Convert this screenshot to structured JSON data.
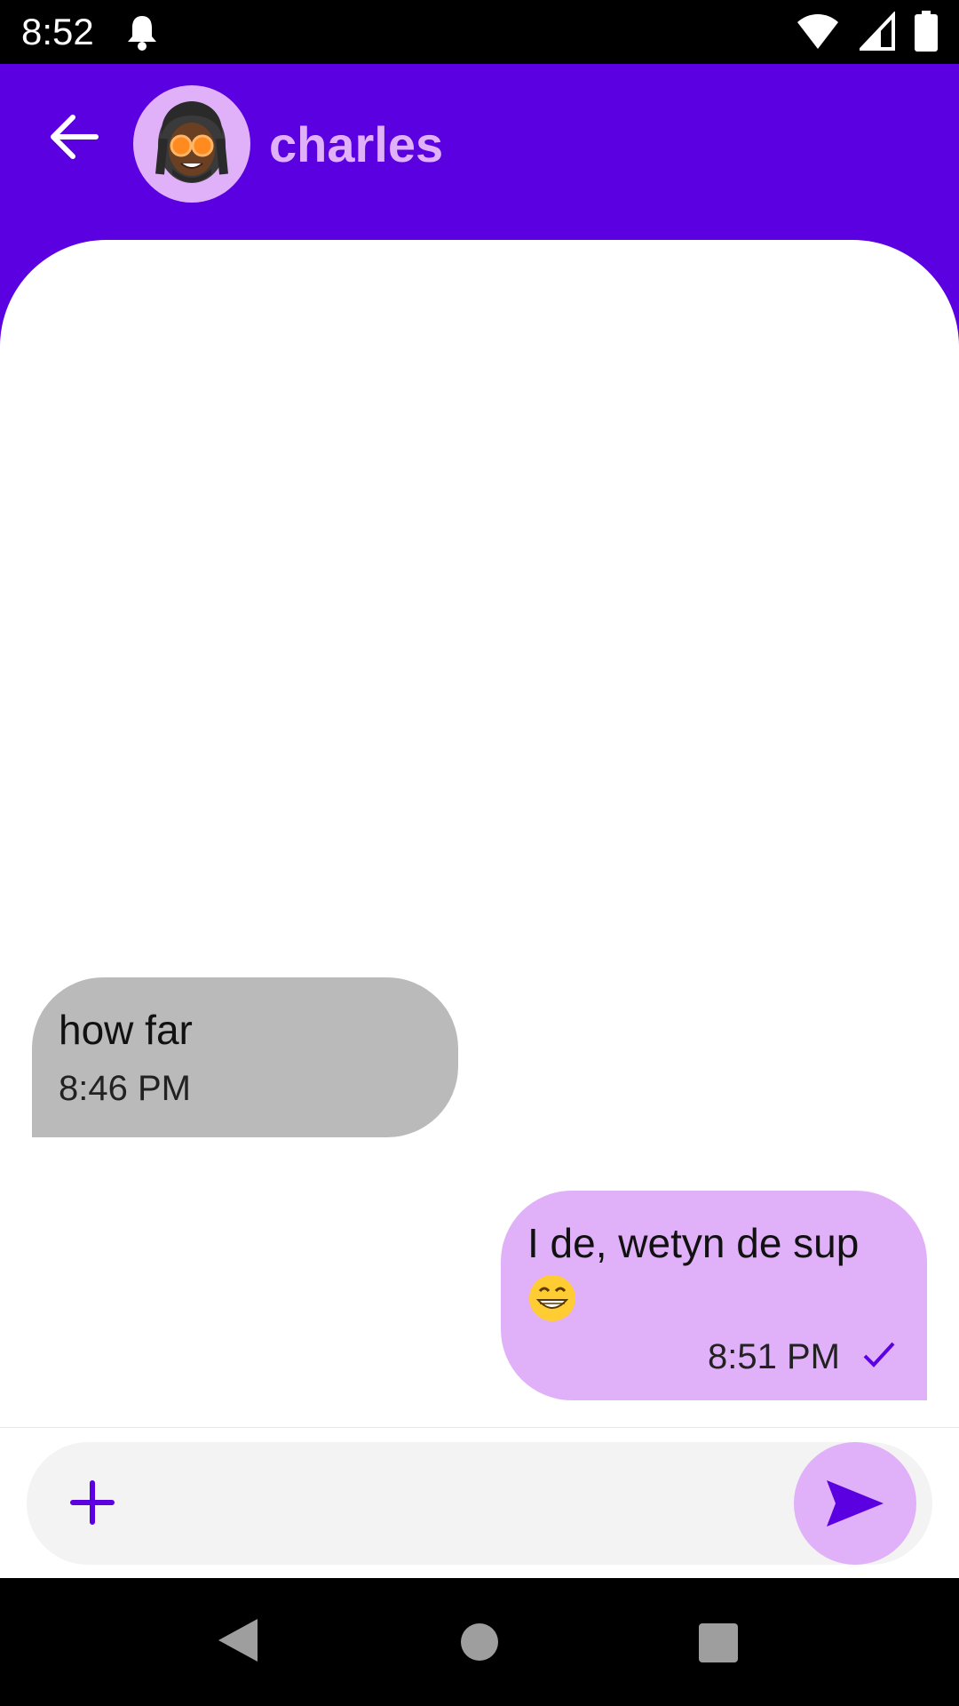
{
  "status_bar": {
    "time": "8:52",
    "icons": [
      "notification-bell-icon",
      "wifi-icon",
      "cellular-signal-icon",
      "battery-icon"
    ]
  },
  "header": {
    "back_icon": "arrow-left-icon",
    "contact_name": "charles",
    "avatar_icon": "memoji-avatar",
    "background_color": "#5b00e0",
    "name_color": "#e0b1f8"
  },
  "messages": [
    {
      "direction": "incoming",
      "text": "how far",
      "time": "8:46 PM",
      "bubble_color": "#bababa"
    },
    {
      "direction": "outgoing",
      "text": "I de, wetyn de sup",
      "emoji": "grinning-face-emoji",
      "time": "8:51 PM",
      "status_icon": "checkmark-icon",
      "bubble_color": "#e0b1f8"
    }
  ],
  "composer": {
    "attach_icon": "plus-icon",
    "placeholder": "",
    "value": "",
    "send_icon": "send-icon"
  },
  "nav_bar": {
    "icons": [
      "nav-back-icon",
      "nav-home-icon",
      "nav-recents-icon"
    ]
  }
}
